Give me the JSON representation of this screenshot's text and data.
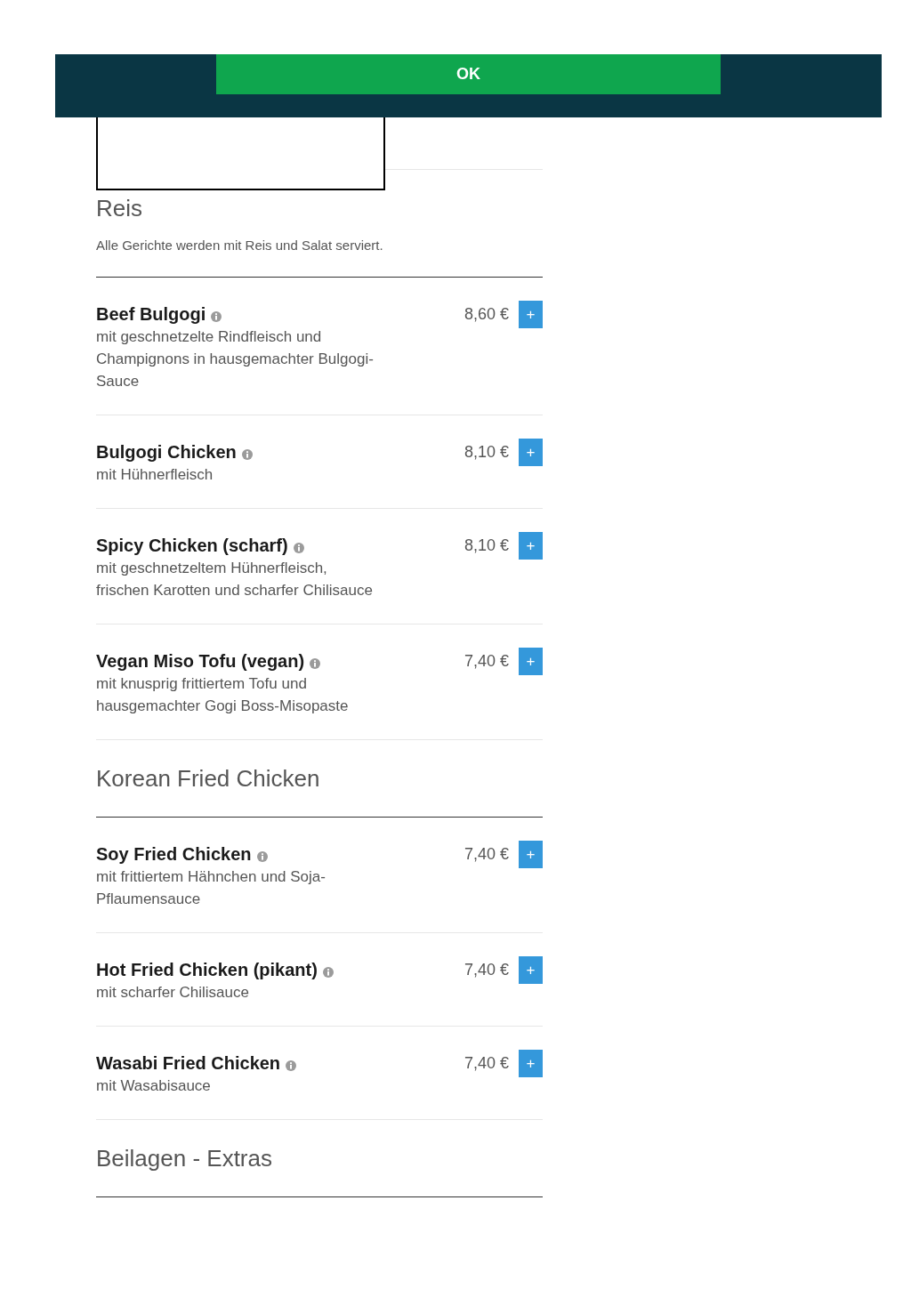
{
  "cookie_banner": {
    "button": "OK"
  },
  "sections": [
    {
      "title": "Reis",
      "subtitle": "Alle Gerichte werden mit Reis und Salat serviert.",
      "items": [
        {
          "name": "Beef Bulgogi",
          "description": "mit geschnetzelte Rindfleisch und Champignons in hausgemachter Bulgogi-Sauce",
          "price": "8,60 €",
          "button": "+"
        },
        {
          "name": "Bulgogi Chicken",
          "description": "mit Hühnerfleisch",
          "price": "8,10 €",
          "button": "+"
        },
        {
          "name": "Spicy Chicken (scharf)",
          "description": "mit geschnetzeltem Hühnerfleisch, frischen Karotten und scharfer Chilisauce",
          "price": "8,10 €",
          "button": "+"
        },
        {
          "name": "Vegan Miso Tofu (vegan)",
          "description": "mit knusprig frittiertem Tofu und hausgemachter Gogi Boss-Misopaste",
          "price": "7,40 €",
          "button": "+"
        }
      ]
    },
    {
      "title": "Korean Fried Chicken",
      "items": [
        {
          "name": "Soy Fried Chicken",
          "description": "mit frittiertem Hähnchen und Soja-Pflaumensauce",
          "price": "7,40 €",
          "button": "+"
        },
        {
          "name": "Hot Fried Chicken (pikant)",
          "description": "mit scharfer Chilisauce",
          "price": "7,40 €",
          "button": "+"
        },
        {
          "name": "Wasabi Fried Chicken",
          "description": "mit Wasabisauce",
          "price": "7,40 €",
          "button": "+"
        }
      ]
    },
    {
      "title": "Beilagen - Extras"
    }
  ]
}
